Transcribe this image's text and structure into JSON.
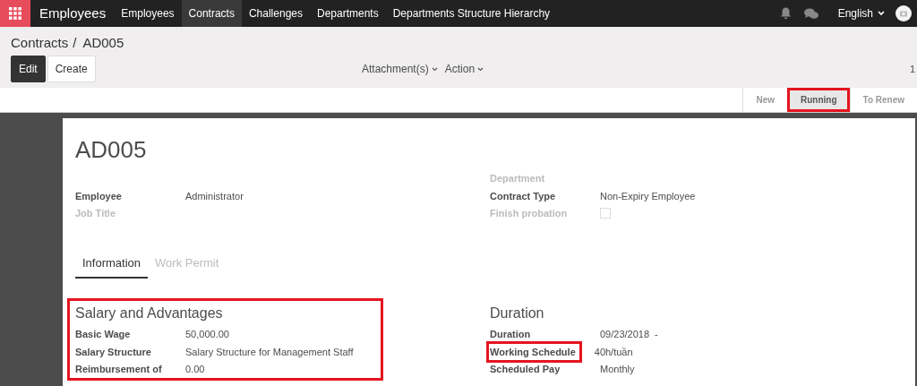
{
  "navbar": {
    "app_title": "Employees",
    "menu": [
      {
        "label": "Employees",
        "selected": false
      },
      {
        "label": "Contracts",
        "selected": true
      },
      {
        "label": "Challenges",
        "selected": false
      },
      {
        "label": "Departments",
        "selected": false
      },
      {
        "label": "Departments Structure Hierarchy",
        "selected": false
      }
    ],
    "language": "English"
  },
  "breadcrumb": {
    "parent": "Contracts",
    "separator": "/",
    "current": "AD005"
  },
  "buttons": [
    {
      "label": "Edit",
      "kind": "primary"
    },
    {
      "label": "Create",
      "kind": "secondary"
    }
  ],
  "dropdowns": [
    "Attachment(s)",
    "Action"
  ],
  "pager": "1",
  "stages": [
    {
      "label": "New",
      "selected": false,
      "highlighted": false
    },
    {
      "label": "Running",
      "selected": true,
      "highlighted": true
    },
    {
      "label": "To Renew",
      "selected": false,
      "highlighted": false
    }
  ],
  "record_title": "AD005",
  "fields_left": [
    {
      "label": "Employee",
      "value": "Administrator"
    },
    {
      "label": "Job Title",
      "disabled": true
    }
  ],
  "fields_right": [
    {
      "label": "Department",
      "disabled": true
    },
    {
      "label": "Contract Type",
      "value": "Non-Expiry Employee"
    },
    {
      "label": "Finish probation",
      "kind": "checkbox",
      "checked": false,
      "disabled": true
    }
  ],
  "tabs": [
    {
      "label": "Information",
      "selected": true
    },
    {
      "label": "Work Permit",
      "selected": false
    }
  ],
  "sections": [
    {
      "title": "Salary and Advantages",
      "highlighted": true,
      "fields": [
        {
          "label": "Basic Wage",
          "value": "50,000.00"
        },
        {
          "label": "Salary Structure",
          "value": "Salary Structure for Management Staff"
        },
        {
          "label": "Reimbursement of",
          "value": "0.00"
        }
      ]
    },
    {
      "title": "Duration",
      "fields": [
        {
          "label": "Duration",
          "value": "09/23/2018",
          "separator": "-"
        },
        {
          "label": "Working Schedule",
          "value": "40h/tuần",
          "highlighted": true
        },
        {
          "label": "Scheduled Pay",
          "value": "Monthly"
        }
      ]
    }
  ]
}
